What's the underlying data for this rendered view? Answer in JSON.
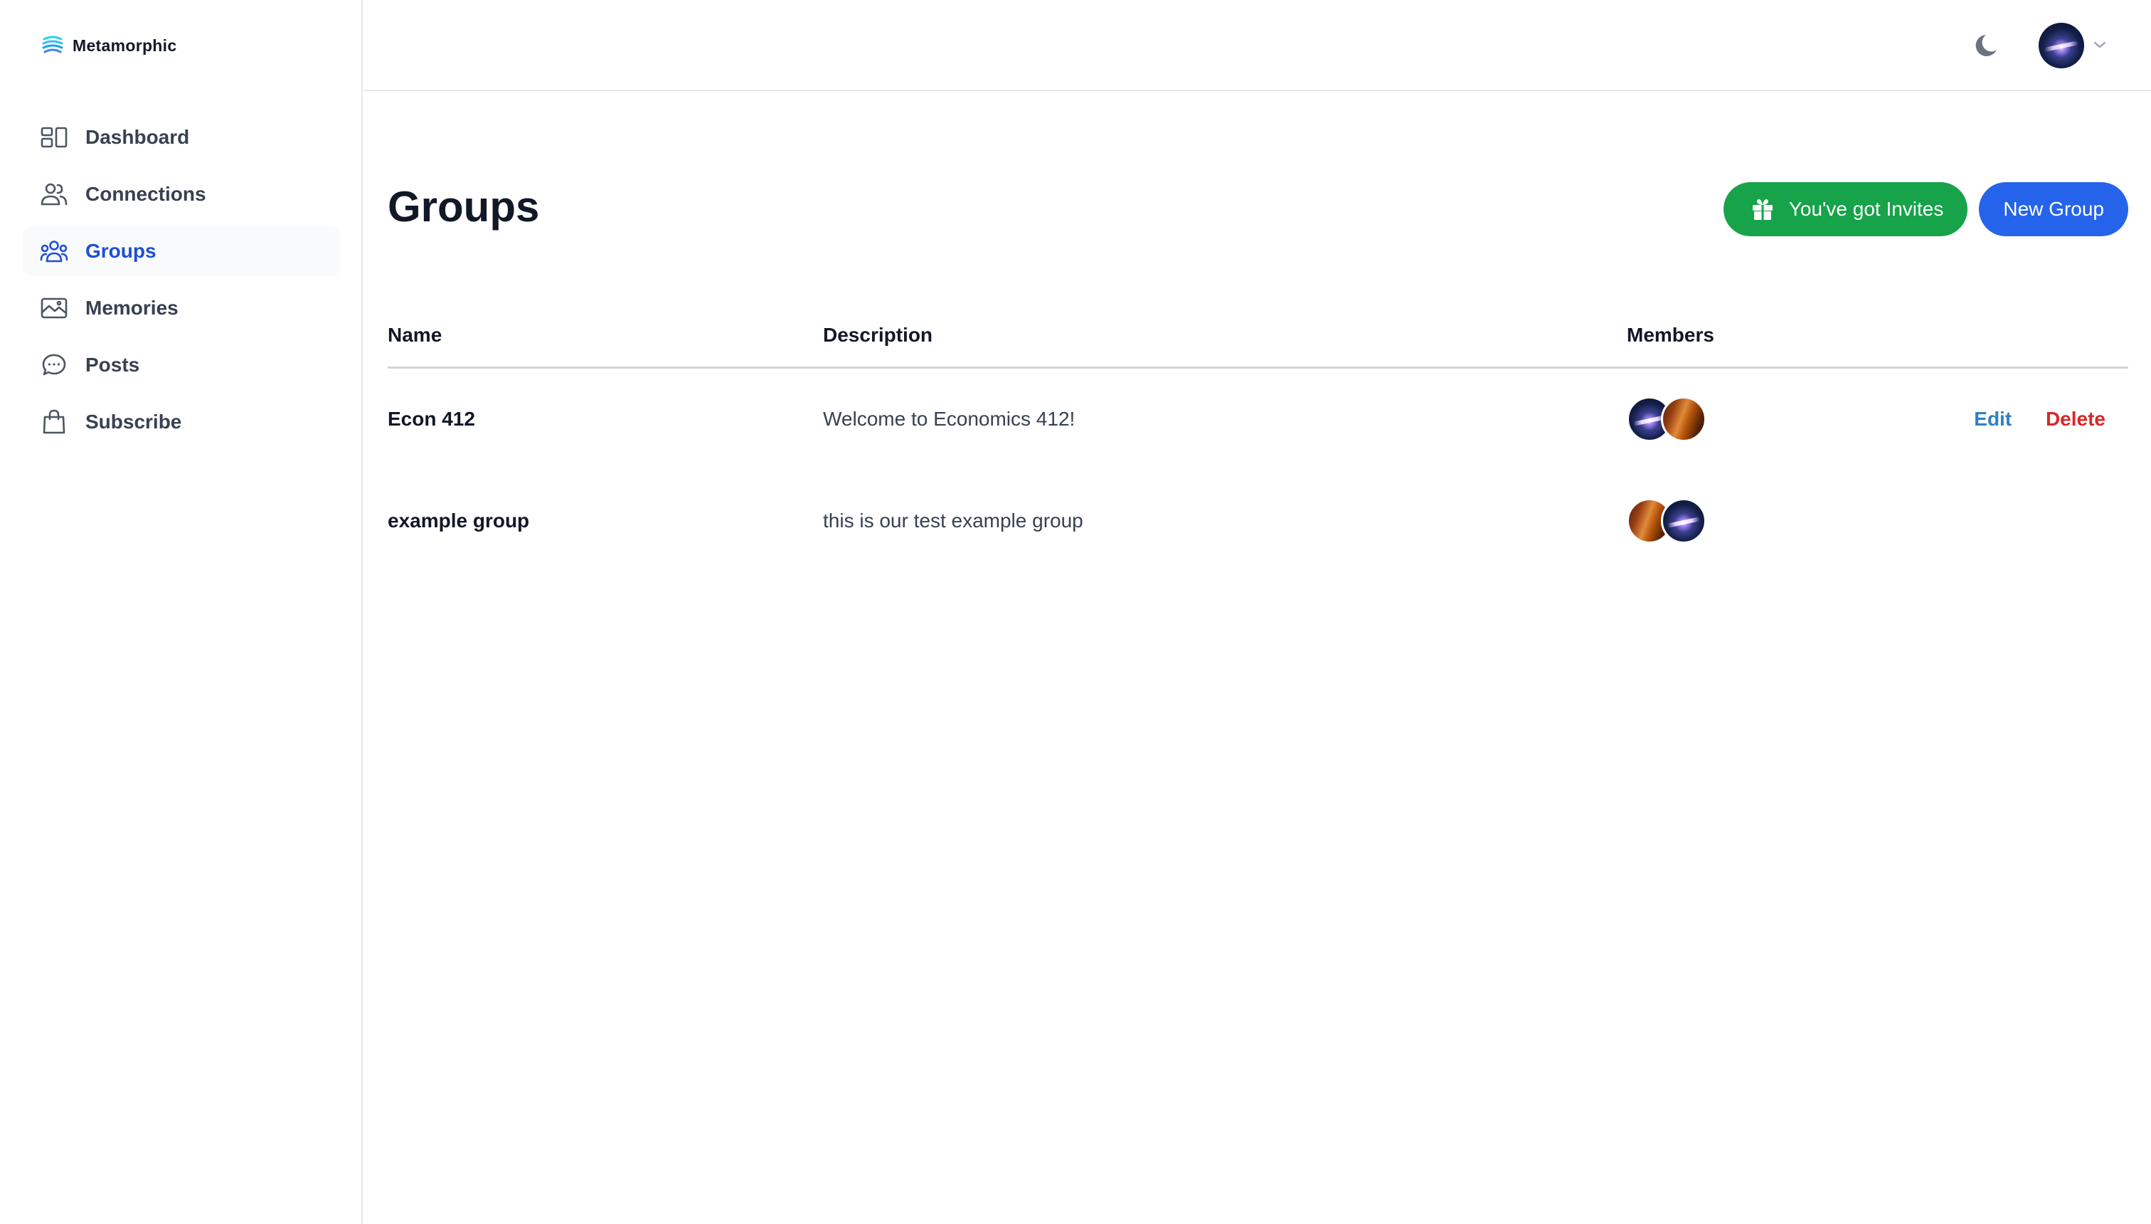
{
  "app": {
    "name": "Metamorphic"
  },
  "sidebar": {
    "items": [
      {
        "label": "Dashboard",
        "icon": "dashboard-icon",
        "active": false
      },
      {
        "label": "Connections",
        "icon": "users-icon",
        "active": false
      },
      {
        "label": "Groups",
        "icon": "user-group-icon",
        "active": true
      },
      {
        "label": "Memories",
        "icon": "photo-icon",
        "active": false
      },
      {
        "label": "Posts",
        "icon": "chat-bubble-icon",
        "active": false
      },
      {
        "label": "Subscribe",
        "icon": "shopping-bag-icon",
        "active": false
      }
    ]
  },
  "header": {
    "theme_icon": "moon-icon",
    "avatar": "galaxy"
  },
  "page": {
    "title": "Groups",
    "invites_button": "You've got Invites",
    "new_group_button": "New Group"
  },
  "table": {
    "columns": [
      "Name",
      "Description",
      "Members"
    ],
    "rows": [
      {
        "name": "Econ 412",
        "description": "Welcome to Economics 412!",
        "members": [
          "galaxy",
          "canyon"
        ],
        "edit": "Edit",
        "delete": "Delete"
      },
      {
        "name": "example group",
        "description": "this is our test example group",
        "members": [
          "canyon",
          "galaxy"
        ]
      }
    ]
  },
  "colors": {
    "primary": "#2563eb",
    "success": "#16a34a",
    "danger": "#dc2626",
    "active_nav_text": "#1d4ed8"
  }
}
